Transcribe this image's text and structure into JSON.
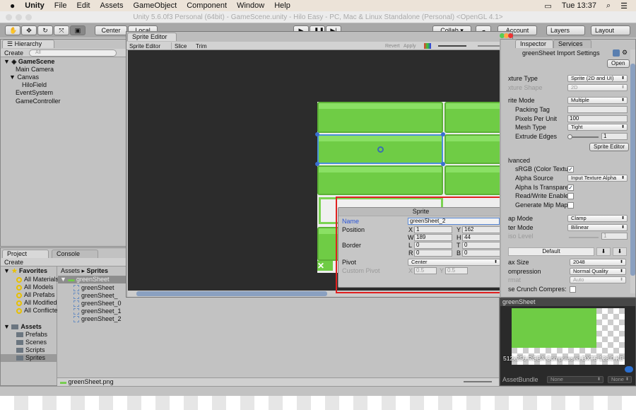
{
  "menubar": {
    "app": "Unity",
    "items": [
      "File",
      "Edit",
      "Assets",
      "GameObject",
      "Component",
      "Window",
      "Help"
    ],
    "clock": "Tue 13:37"
  },
  "window_title": "Unity 5.6.0f3 Personal (64bit) - GameScene.unity - Hilo Easy - PC, Mac & Linux Standalone (Personal) <OpenGL 4.1>",
  "toolbar": {
    "center": "Center",
    "local": "Local",
    "collab": "Collab ▾",
    "account": "Account",
    "layers": "Layers",
    "layout": "Layout"
  },
  "hierarchy": {
    "tab": "Hierarchy",
    "create": "Create",
    "search_placeholder": "All",
    "scene": "GameScene",
    "items": [
      "Main Camera",
      "Canvas",
      "HiloField",
      "EventSystem",
      "GameController"
    ]
  },
  "sprite_editor": {
    "tab": "Sprite Editor",
    "mode": "Sprite Editor",
    "slice": "Slice",
    "trim": "Trim",
    "revert": "Revert",
    "apply": "Apply",
    "sprite_panel": {
      "title": "Sprite",
      "name_label": "Name",
      "name": "greenSheet_2",
      "position_label": "Position",
      "x": "1",
      "y": "162",
      "w": "189",
      "h": "44",
      "border_label": "Border",
      "l": "0",
      "t": "0",
      "r": "0",
      "b": "0",
      "pivot_label": "Pivot",
      "pivot": "Center",
      "custom_pivot_label": "Custom Pivot",
      "cx": "0.5",
      "cy": "0.5"
    }
  },
  "inspector": {
    "tab": "Inspector",
    "services": "Services",
    "title": "greenSheet Import Settings",
    "open": "Open",
    "texture_type_label": "xture Type",
    "texture_type": "Sprite (2D and UI)",
    "texture_shape_label": "xture Shape",
    "texture_shape": "2D",
    "sprite_mode_label": "rite Mode",
    "sprite_mode": "Multiple",
    "packing_tag_label": "Packing Tag",
    "ppu_label": "Pixels Per Unit",
    "ppu": "100",
    "mesh_type_label": "Mesh Type",
    "mesh_type": "Tight",
    "extrude_label": "Extrude Edges",
    "extrude": "1",
    "extrude_fraction": 0.0,
    "sprite_editor_btn": "Sprite Editor",
    "advanced": "lvanced",
    "srgb_label": "sRGB (Color Textur",
    "srgb": true,
    "alpha_source_label": "Alpha Source",
    "alpha_source": "Input Texture Alpha",
    "alpha_transparent_label": "Alpha Is Transpare",
    "alpha_transparent": true,
    "rw_label": "Read/Write Enablec",
    "rw": false,
    "mip_label": "Generate Mip Maps",
    "mip": false,
    "wrap_label": "ap Mode",
    "wrap": "Clamp",
    "filter_label": "ter Mode",
    "filter": "Bilinear",
    "aniso_label": "iso Level",
    "aniso": "1",
    "platform_default": "Default",
    "max_size_label": "ax Size",
    "max_size": "2048",
    "compression_label": "ompression",
    "compression": "Normal Quality",
    "format_label": "rmat",
    "format": "Auto",
    "crunch_label": "se Crunch Compres:",
    "crunch": false
  },
  "preview": {
    "title": "greenSheet",
    "info": "512x256  RGBA Compressed DXT5    128.0 KB",
    "assetbundle_label": "AssetBundle",
    "ab_name": "None",
    "ab_variant": "None"
  },
  "project": {
    "tab": "Project",
    "console": "Console",
    "create": "Create",
    "favorites": "Favorites",
    "fav_items": [
      "All Materials",
      "All Models",
      "All Prefabs",
      "All Modified",
      "All Conflicte"
    ],
    "assets": "Assets",
    "folders": [
      "Prefabs",
      "Scenes",
      "Scripts",
      "Sprites"
    ],
    "breadcrumb": [
      "Assets",
      "Sprites"
    ],
    "sheet": "greenSheet",
    "sprites": [
      "greenSheet",
      "greenSheet_",
      "greenSheet_0",
      "greenSheet_1",
      "greenSheet_2"
    ],
    "selected_file": "greenSheet.png"
  }
}
